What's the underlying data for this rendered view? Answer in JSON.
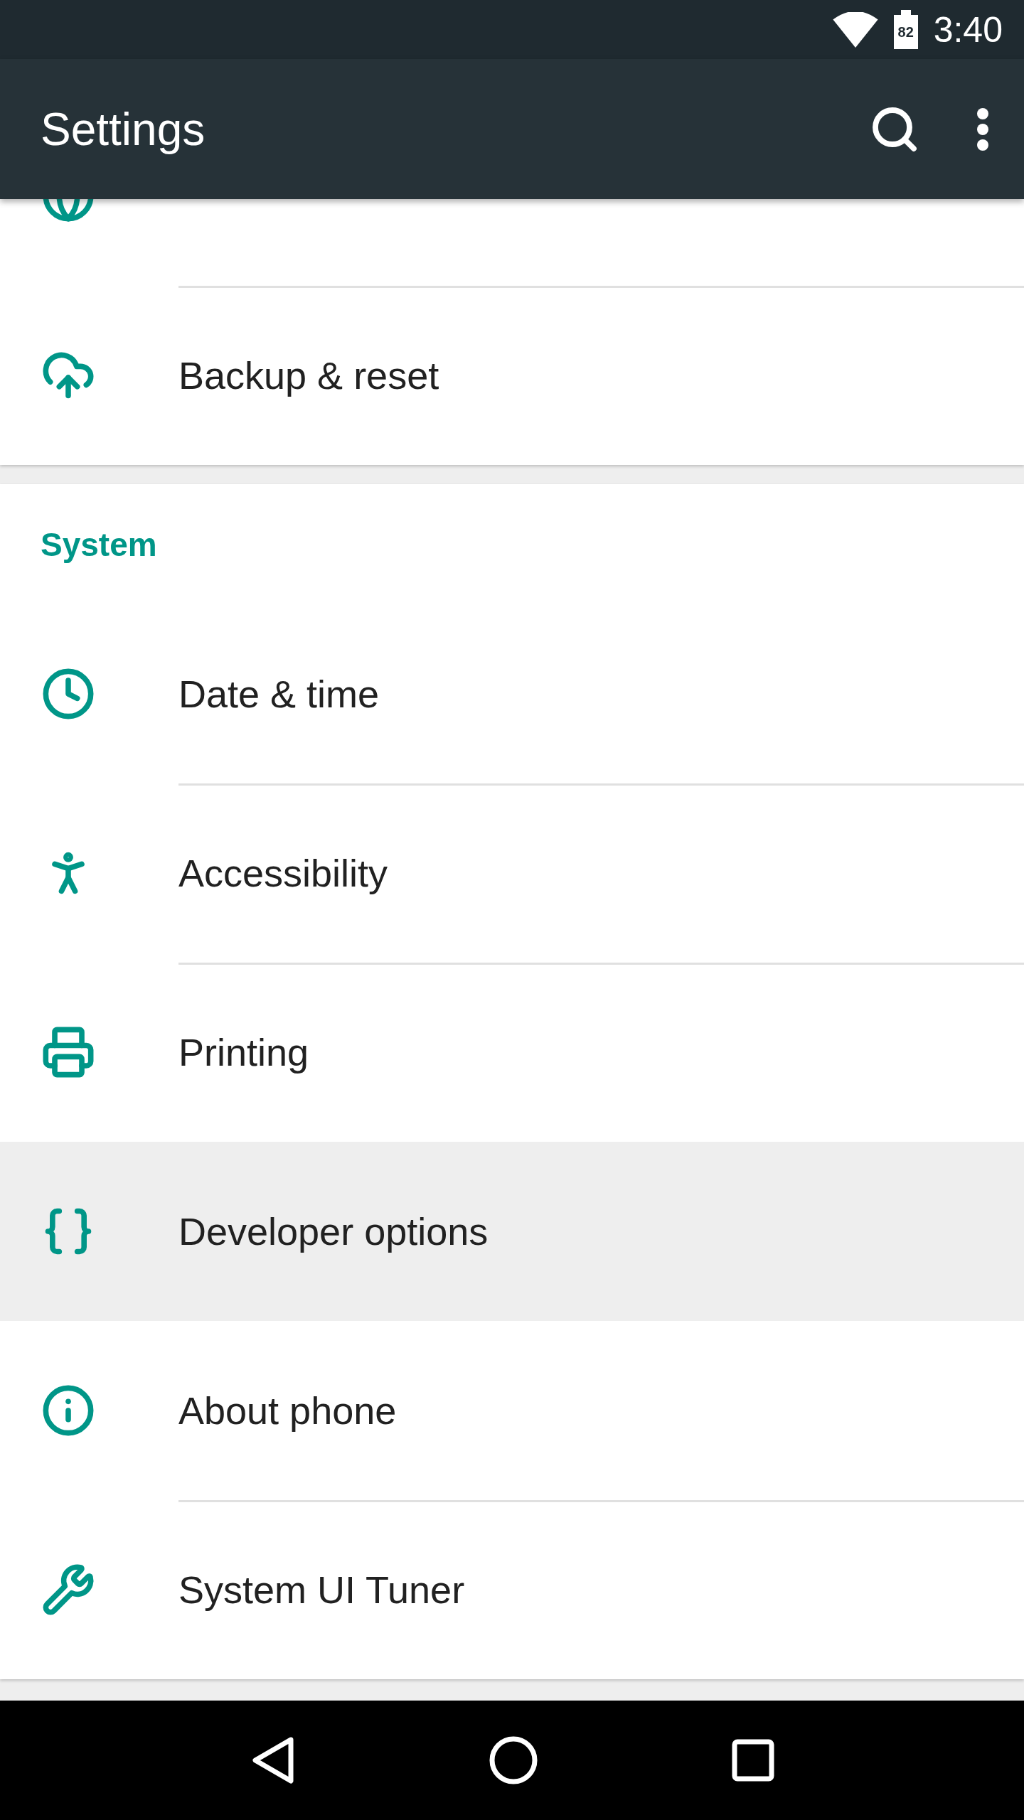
{
  "status_bar": {
    "battery": "82",
    "time": "3:40"
  },
  "app_bar": {
    "title": "Settings"
  },
  "sections": [
    {
      "items": [
        {
          "selected": false
        },
        {
          "label": "Backup & reset",
          "selected": false
        }
      ]
    },
    {
      "header": "System",
      "items": [
        {
          "label": "Date & time",
          "selected": false
        },
        {
          "label": "Accessibility",
          "selected": false
        },
        {
          "label": "Printing",
          "selected": false
        },
        {
          "label": "Developer options",
          "selected": true
        },
        {
          "label": "About phone",
          "selected": false
        },
        {
          "label": "System UI Tuner",
          "selected": false
        }
      ]
    }
  ]
}
